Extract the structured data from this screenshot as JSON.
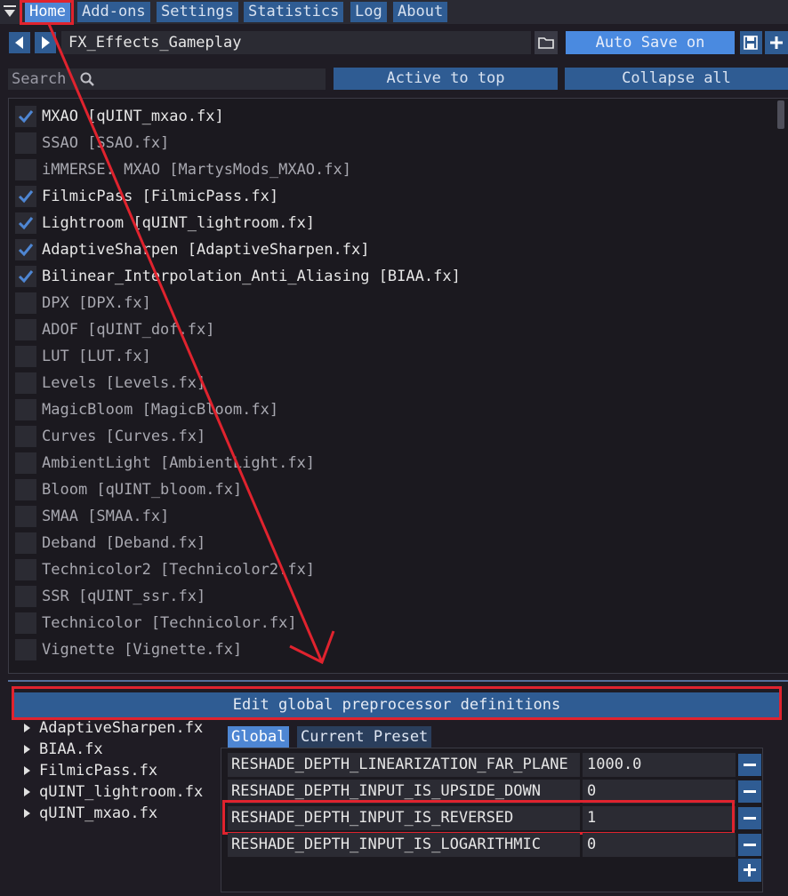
{
  "menu": {
    "tabs": [
      "Home",
      "Add-ons",
      "Settings",
      "Statistics",
      "Log",
      "About"
    ],
    "active": "Home"
  },
  "preset": {
    "name": "FX_Effects_Gameplay",
    "auto_save_label": "Auto Save on"
  },
  "toolbar": {
    "search_label": "Search",
    "active_to_top_label": "Active to top",
    "collapse_all_label": "Collapse all"
  },
  "effects": [
    {
      "label": "MXAO [qUINT_mxao.fx]",
      "enabled": true
    },
    {
      "label": "SSAO [SSAO.fx]",
      "enabled": false
    },
    {
      "label": "iMMERSE: MXAO [MartysMods_MXAO.fx]",
      "enabled": false
    },
    {
      "label": "FilmicPass [FilmicPass.fx]",
      "enabled": true
    },
    {
      "label": "Lightroom [qUINT_lightroom.fx]",
      "enabled": true
    },
    {
      "label": "AdaptiveSharpen [AdaptiveSharpen.fx]",
      "enabled": true
    },
    {
      "label": "Bilinear_Interpolation_Anti_Aliasing [BIAA.fx]",
      "enabled": true
    },
    {
      "label": "DPX [DPX.fx]",
      "enabled": false
    },
    {
      "label": "ADOF [qUINT_dof.fx]",
      "enabled": false
    },
    {
      "label": "LUT [LUT.fx]",
      "enabled": false
    },
    {
      "label": "Levels [Levels.fx]",
      "enabled": false
    },
    {
      "label": "MagicBloom [MagicBloom.fx]",
      "enabled": false
    },
    {
      "label": "Curves [Curves.fx]",
      "enabled": false
    },
    {
      "label": "AmbientLight [AmbientLight.fx]",
      "enabled": false
    },
    {
      "label": "Bloom [qUINT_bloom.fx]",
      "enabled": false
    },
    {
      "label": "SMAA [SMAA.fx]",
      "enabled": false
    },
    {
      "label": "Deband [Deband.fx]",
      "enabled": false
    },
    {
      "label": "Technicolor2 [Technicolor2.fx]",
      "enabled": false
    },
    {
      "label": "SSR [qUINT_ssr.fx]",
      "enabled": false
    },
    {
      "label": "Technicolor [Technicolor.fx]",
      "enabled": false
    },
    {
      "label": "Vignette [Vignette.fx]",
      "enabled": false
    }
  ],
  "preprocessor": {
    "edit_button_label": "Edit global preprocessor definitions",
    "files": [
      "AdaptiveSharpen.fx",
      "BIAA.fx",
      "FilmicPass.fx",
      "qUINT_lightroom.fx",
      "qUINT_mxao.fx"
    ],
    "tabs": [
      "Global",
      "Current Preset"
    ],
    "active_tab": "Global",
    "definitions": [
      {
        "name": "RESHADE_DEPTH_LINEARIZATION_FAR_PLANE",
        "value": "1000.0"
      },
      {
        "name": "RESHADE_DEPTH_INPUT_IS_UPSIDE_DOWN",
        "value": "0"
      },
      {
        "name": "RESHADE_DEPTH_INPUT_IS_REVERSED",
        "value": "1"
      },
      {
        "name": "RESHADE_DEPTH_INPUT_IS_LOGARITHMIC",
        "value": "0"
      }
    ]
  },
  "colors": {
    "accent": "#4e86d3",
    "button": "#2f5c93",
    "highlight": "#e0232e",
    "background": "#1f1c24"
  }
}
